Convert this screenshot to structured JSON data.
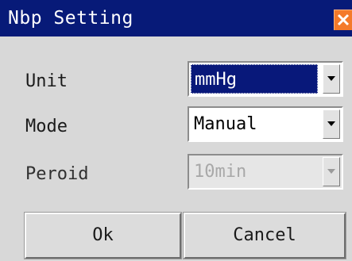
{
  "dialog": {
    "title": "Nbp Setting",
    "close_icon": "close-icon"
  },
  "rows": {
    "unit": {
      "label": "Unit",
      "value": "mmHg"
    },
    "mode": {
      "label": "Mode",
      "value": "Manual"
    },
    "period": {
      "label": "Peroid",
      "value": "10min"
    }
  },
  "buttons": {
    "ok": "Ok",
    "cancel": "Cancel"
  },
  "colors": {
    "titlebar": "#071a78",
    "close": "#f47a2a",
    "selection": "#08187a"
  }
}
